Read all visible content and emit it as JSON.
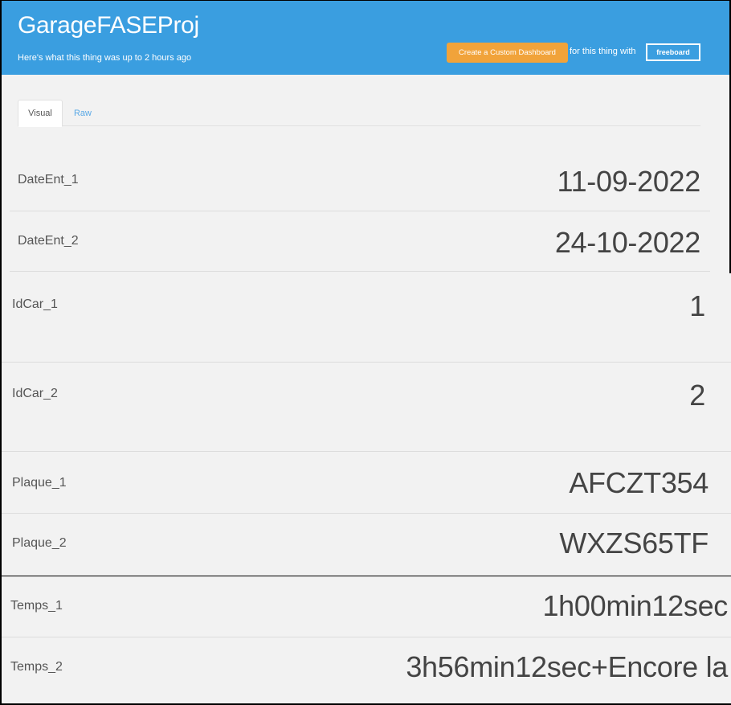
{
  "header": {
    "title": "GarageFASEProj",
    "subtitle": "Here's what this thing was up to 2 hours ago",
    "dashboard_button": "Create a Custom Dashboard",
    "dashboard_suffix": "for this thing with",
    "freeboard_logo": "freeboard",
    "accent_color": "#3a9ee0",
    "button_color": "#f1a33a"
  },
  "tabs": [
    {
      "label": "Visual",
      "active": true
    },
    {
      "label": "Raw",
      "active": false
    }
  ],
  "rows": [
    {
      "label": "DateEnt_1",
      "value": "11-09-2022"
    },
    {
      "label": "DateEnt_2",
      "value": "24-10-2022"
    },
    {
      "label": "IdCar_1",
      "value": "1"
    },
    {
      "label": "IdCar_2",
      "value": "2"
    },
    {
      "label": "Plaque_1",
      "value": "AFCZT354"
    },
    {
      "label": "Plaque_2",
      "value": "WXZS65TF"
    },
    {
      "label": "Temps_1",
      "value": "1h00min12sec"
    },
    {
      "label": "Temps_2",
      "value": "3h56min12sec+Encore la"
    }
  ]
}
